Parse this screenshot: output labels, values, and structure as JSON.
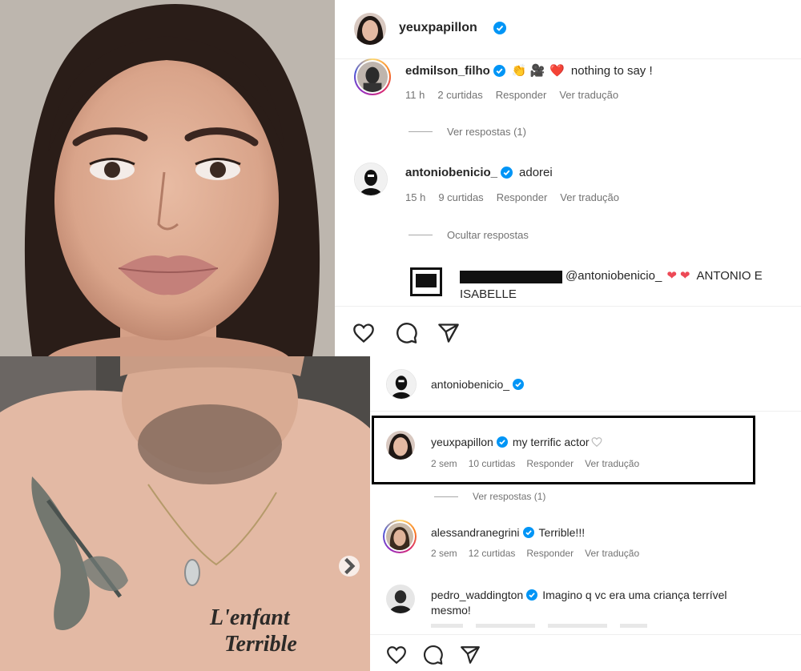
{
  "top_post": {
    "author": "yeuxpapillon",
    "comments": [
      {
        "username": "edmilson_filho",
        "text": "nothing to say !",
        "emojis": [
          "👏",
          "🎥",
          "❤️"
        ],
        "time": "11 h",
        "likes": "2 curtidas",
        "reply": "Responder",
        "translate": "Ver tradução",
        "replies_label": "Ver respostas (1)"
      },
      {
        "username": "antoniobenicio_",
        "text": "adorei",
        "time": "15 h",
        "likes": "9 curtidas",
        "reply": "Responder",
        "translate": "Ver tradução",
        "replies_label": "Ocultar respostas"
      }
    ],
    "nested_reply": {
      "mention": "@antoniobenicio_",
      "text_after_hearts": "ANTONIO E",
      "text_line2": "ISABELLE"
    }
  },
  "bottom_post": {
    "author": "antoniobenicio_",
    "tattoo_line1": "L'enfant",
    "tattoo_line2": "Terrible",
    "comments": [
      {
        "username": "yeuxpapillon",
        "text": "my terrific actor",
        "time": "2 sem",
        "likes": "10 curtidas",
        "reply": "Responder",
        "translate": "Ver tradução",
        "replies_label": "Ver respostas (1)"
      },
      {
        "username": "alessandranegrini",
        "text": "Terrible!!!",
        "time": "2 sem",
        "likes": "12 curtidas",
        "reply": "Responder",
        "translate": "Ver tradução"
      },
      {
        "username": "pedro_waddington",
        "text_line1": "Imagino q vc era uma criança terrível",
        "text_line2": "mesmo!"
      }
    ]
  },
  "icons": [
    "heart-icon",
    "comment-icon",
    "share-icon",
    "verified-icon",
    "carousel-next-icon"
  ],
  "colors": {
    "verified": "#0095f6",
    "heart": "#ed4956",
    "highlight_box": "#000000",
    "muted_text": "#737373"
  }
}
